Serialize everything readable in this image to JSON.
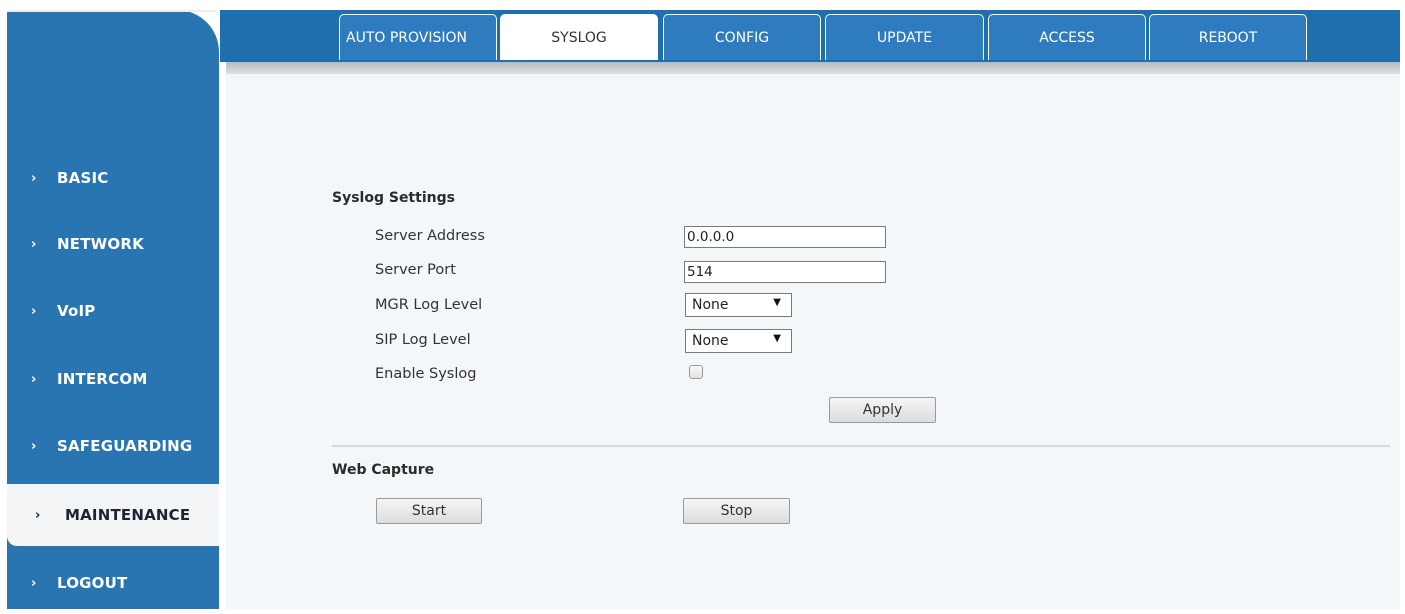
{
  "sidebar": {
    "items": [
      {
        "label": "BASIC"
      },
      {
        "label": "NETWORK"
      },
      {
        "label": "VoIP"
      },
      {
        "label": "INTERCOM"
      },
      {
        "label": "SAFEGUARDING"
      },
      {
        "label": "MAINTENANCE",
        "active": true
      },
      {
        "label": "LOGOUT"
      }
    ],
    "chevron": "›"
  },
  "tabs": [
    {
      "label": "AUTO PROVISION"
    },
    {
      "label": "SYSLOG",
      "active": true
    },
    {
      "label": "CONFIG"
    },
    {
      "label": "UPDATE"
    },
    {
      "label": "ACCESS"
    },
    {
      "label": "REBOOT"
    }
  ],
  "syslog": {
    "title": "Syslog Settings",
    "server_address_label": "Server Address",
    "server_address_value": "0.0.0.0",
    "server_port_label": "Server Port",
    "server_port_value": "514",
    "mgr_log_level_label": "MGR Log Level",
    "mgr_log_level_value": "None",
    "sip_log_level_label": "SIP Log Level",
    "sip_log_level_value": "None",
    "enable_syslog_label": "Enable Syslog",
    "enable_syslog_checked": false,
    "apply_label": "Apply"
  },
  "web_capture": {
    "title": "Web Capture",
    "start_label": "Start",
    "stop_label": "Stop"
  },
  "colors": {
    "sidebar": "#2975b1",
    "tabbar": "#1f6fae",
    "content_bg": "#f3f7fa"
  }
}
